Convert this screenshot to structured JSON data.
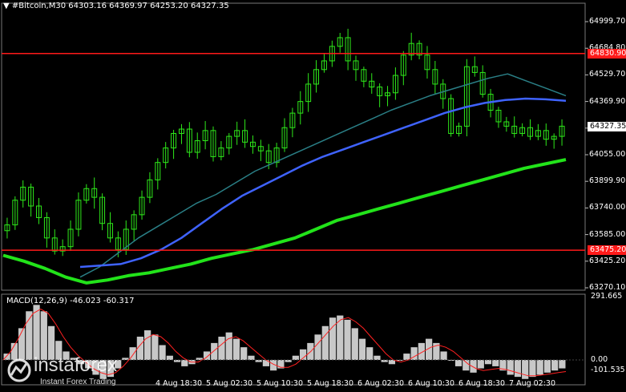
{
  "header": {
    "arrow": "▼",
    "symbol": "#Bitcoin,M30",
    "ohlc": "64303.16 64369.97 64253.20 64327.35"
  },
  "indicator": {
    "label": "MACD(12,26,9)",
    "values": "-46.023 -60.317",
    "axis_ticks": [
      "291.665",
      "0.00",
      "-101.535"
    ]
  },
  "price_axis": [
    "64999.70",
    "64684.80",
    "64529.70",
    "64369.90",
    "64214.80",
    "64055.00",
    "63899.90",
    "63740.00",
    "63585.00",
    "63425.20",
    "63270.10"
  ],
  "time_axis": [
    "4 Aug 18:30",
    "5 Aug 02:30",
    "5 Aug 10:30",
    "5 Aug 18:30",
    "6 Aug 02:30",
    "6 Aug 10:30",
    "6 Aug 18:30",
    "7 Aug 02:30"
  ],
  "levels": {
    "resistance": "64830.90",
    "support": "63475.20",
    "current": "64327.35"
  },
  "colors": {
    "background": "#000000",
    "candles": "#2ee81a",
    "red_line": "#ff1a1a",
    "ma_fast": "#2a7f86",
    "ma_mid": "#3f63ff",
    "ma_slow": "#22e31a",
    "macd_hist": "#c8c8c8",
    "macd_signal": "#ff2020"
  },
  "watermark": {
    "brand": "instaforex",
    "tagline": "Instant Forex Trading"
  },
  "chart_data": {
    "type": "line",
    "ylim": [
      63200,
      65100
    ],
    "series": [
      {
        "name": "close",
        "values": [
          63650,
          63820,
          63910,
          63780,
          63700,
          63560,
          63470,
          63500,
          63620,
          63820,
          63900,
          63840,
          63660,
          63560,
          63480,
          63620,
          63720,
          63840,
          63960,
          64080,
          64180,
          64280,
          64310,
          64150,
          64230,
          64300,
          64120,
          64180,
          64260,
          64300,
          64220,
          64190,
          64160,
          64080,
          64180,
          64320,
          64420,
          64500,
          64620,
          64720,
          64780,
          64880,
          64940,
          64780,
          64720,
          64640,
          64600,
          64540,
          64560,
          64680,
          64820,
          64900,
          64820,
          64720,
          64620,
          64520,
          64280,
          64330,
          64740,
          64700,
          64550,
          64440,
          64360,
          64330,
          64280,
          64320,
          64260,
          64300,
          64240,
          64260,
          64330
        ]
      }
    ],
    "moving_averages": [
      {
        "values": [
          63290,
          63360,
          63460,
          63560,
          63640,
          63720,
          63800,
          63860,
          63940,
          64020,
          64080,
          64140,
          64200,
          64260,
          64320,
          64380,
          64440,
          64490,
          64540,
          64580,
          64620,
          64660,
          64690,
          64640,
          64590,
          64540
        ]
      },
      {
        "values": [
          63360,
          63370,
          63380,
          63420,
          63480,
          63560,
          63660,
          63760,
          63850,
          63920,
          63990,
          64060,
          64120,
          64170,
          64220,
          64270,
          64320,
          64370,
          64420,
          64460,
          64490,
          64510,
          64520,
          64515,
          64505
        ]
      },
      {
        "values": [
          63440,
          63400,
          63350,
          63290,
          63250,
          63270,
          63300,
          63320,
          63350,
          63380,
          63420,
          63450,
          63480,
          63520,
          63560,
          63620,
          63680,
          63720,
          63760,
          63800,
          63840,
          63880,
          63920,
          63960,
          64000,
          64040,
          64070,
          64100
        ]
      }
    ],
    "macd": {
      "histogram": [
        30,
        80,
        150,
        230,
        260,
        230,
        160,
        90,
        40,
        10,
        -20,
        -40,
        -70,
        -90,
        -80,
        -40,
        10,
        60,
        110,
        140,
        120,
        70,
        20,
        -10,
        -30,
        -20,
        10,
        40,
        80,
        110,
        130,
        100,
        60,
        20,
        -10,
        -30,
        -50,
        -40,
        -10,
        20,
        50,
        80,
        120,
        160,
        200,
        210,
        190,
        150,
        100,
        60,
        20,
        -10,
        -20,
        0,
        30,
        60,
        80,
        100,
        80,
        40,
        0,
        -30,
        -50,
        -60,
        -40,
        -20,
        -30,
        -50,
        -70,
        -80,
        -90,
        -80,
        -70,
        -60,
        -50,
        -40
      ],
      "signal": [
        0,
        40,
        100,
        170,
        220,
        240,
        220,
        170,
        110,
        60,
        20,
        -10,
        -40,
        -60,
        -70,
        -60,
        -30,
        10,
        60,
        100,
        120,
        110,
        80,
        40,
        10,
        -10,
        -10,
        10,
        40,
        70,
        100,
        110,
        90,
        60,
        30,
        0,
        -20,
        -35,
        -35,
        -20,
        10,
        40,
        80,
        120,
        160,
        190,
        200,
        180,
        150,
        110,
        70,
        30,
        0,
        -10,
        0,
        20,
        40,
        60,
        70,
        60,
        40,
        10,
        -20,
        -40,
        -50,
        -45,
        -40,
        -45,
        -55,
        -65,
        -75,
        -75,
        -70,
        -65,
        -60,
        -55
      ]
    }
  }
}
